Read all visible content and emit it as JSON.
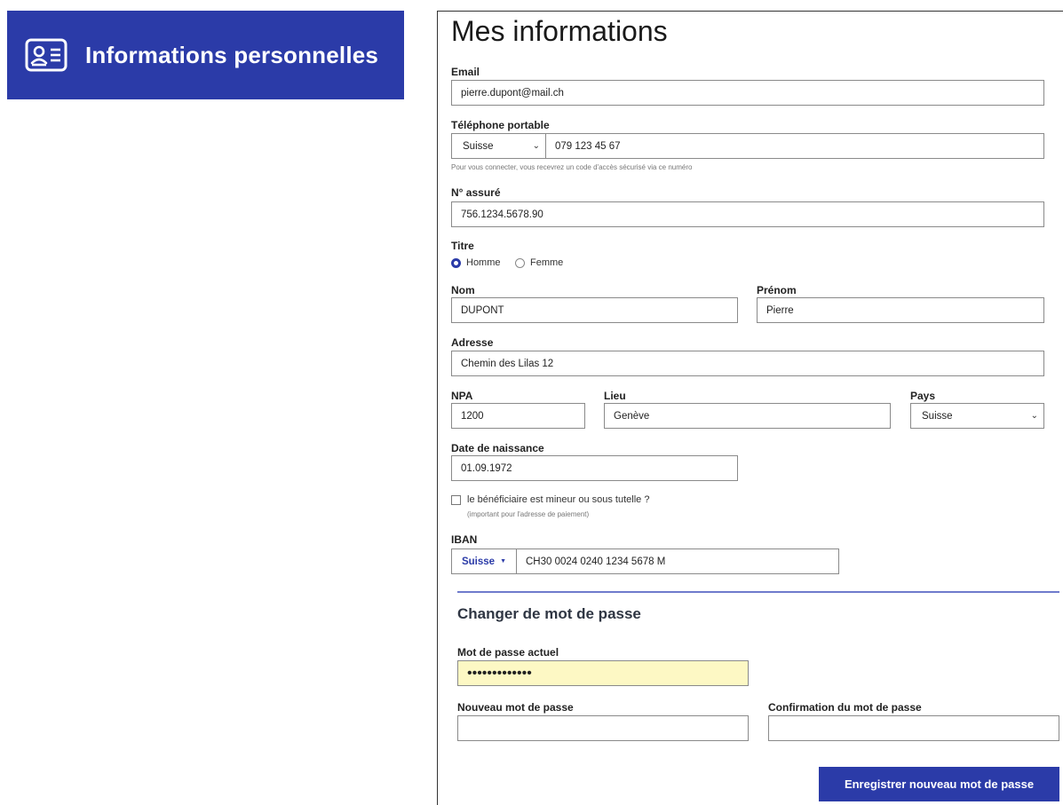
{
  "banner": {
    "title": "Informations personnelles"
  },
  "form": {
    "title": "Mes informations",
    "email": {
      "label": "Email",
      "value": "pierre.dupont@mail.ch"
    },
    "phone": {
      "label": "Téléphone portable",
      "country": "Suisse",
      "value": "079 123 45 67",
      "hint": "Pour vous connecter, vous recevrez un code d'accès sécurisé via ce numéro"
    },
    "insured": {
      "label": "N° assuré",
      "value": "756.1234.5678.90"
    },
    "title_field": {
      "label": "Titre",
      "options": [
        "Homme",
        "Femme"
      ],
      "selected": "Homme"
    },
    "lastname": {
      "label": "Nom",
      "value": "DUPONT"
    },
    "firstname": {
      "label": "Prénom",
      "value": "Pierre"
    },
    "address": {
      "label": "Adresse",
      "value": "Chemin des Lilas 12"
    },
    "npa": {
      "label": "NPA",
      "value": "1200"
    },
    "city": {
      "label": "Lieu",
      "value": "Genève"
    },
    "country": {
      "label": "Pays",
      "value": "Suisse"
    },
    "birthdate": {
      "label": "Date de naissance",
      "value": "01.09.1972"
    },
    "minor": {
      "label": "le bénéficiaire est mineur ou sous tutelle ?",
      "note": "(important pour l'adresse de paiement)",
      "checked": false
    },
    "iban": {
      "label": "IBAN",
      "country": "Suisse",
      "value": "CH30 0024 0240 1234 5678 M"
    }
  },
  "password": {
    "title": "Changer de mot de passe",
    "current": {
      "label": "Mot de passe actuel",
      "value": "•••••••••••••"
    },
    "new": {
      "label": "Nouveau mot de passe",
      "value": ""
    },
    "confirm": {
      "label": "Confirmation du mot de passe",
      "value": ""
    },
    "save_label": "Enregistrer nouveau mot de passe"
  },
  "colors": {
    "brand": "#2b3ba8",
    "autofill": "#fdf8c4"
  }
}
